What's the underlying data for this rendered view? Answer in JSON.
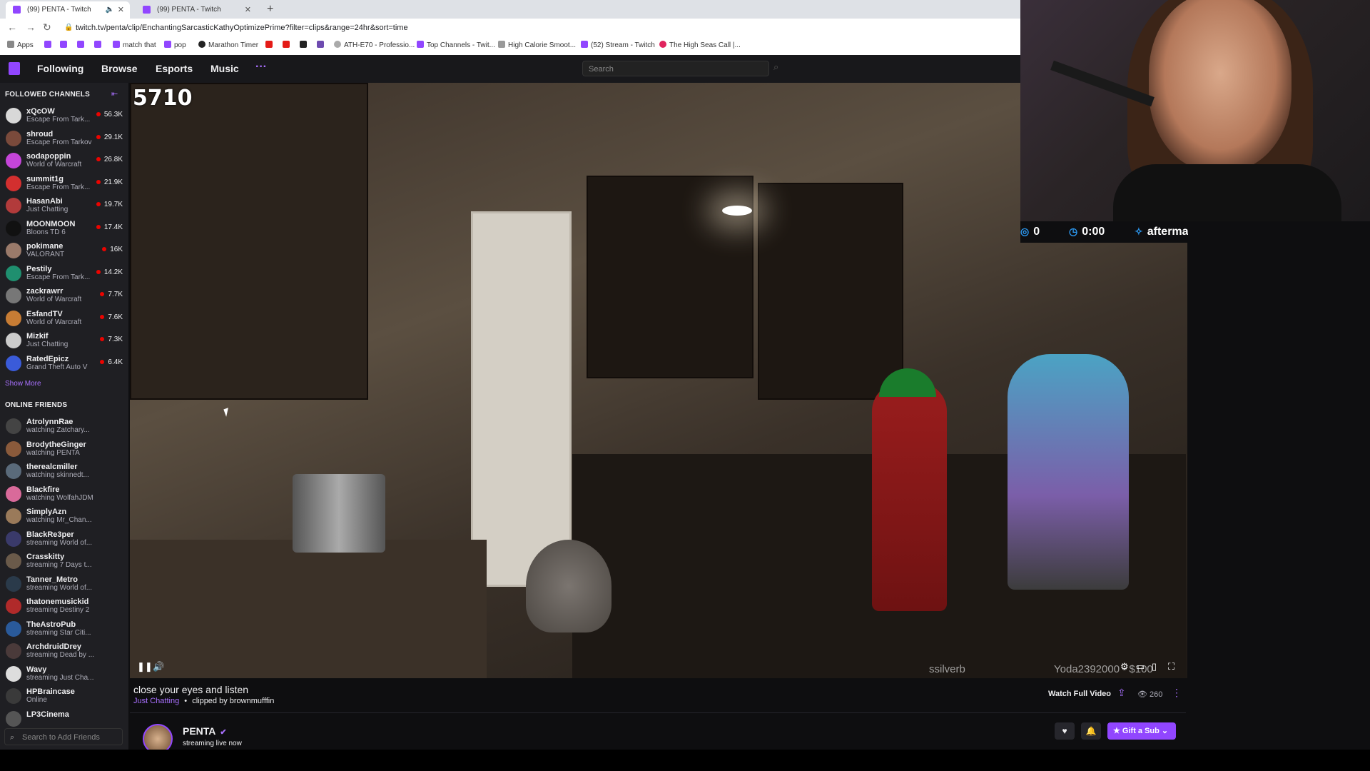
{
  "browser": {
    "tabs": [
      {
        "title": "(99) PENTA - Twitch"
      },
      {
        "title": "(99) PENTA - Twitch"
      }
    ],
    "url": "twitch.tv/penta/clip/EnchantingSarcasticKathyOptimizePrime?filter=clips&range=24hr&sort=time",
    "bookmarks": [
      {
        "label": "Apps",
        "color": "#888888"
      },
      {
        "label": "",
        "color": "#9146ff"
      },
      {
        "label": "",
        "color": "#9146ff"
      },
      {
        "label": "",
        "color": "#9146ff"
      },
      {
        "label": "",
        "color": "#9146ff"
      },
      {
        "label": "match that",
        "color": "#9146ff"
      },
      {
        "label": "pop",
        "color": "#9146ff"
      },
      {
        "label": "Marathon Timer",
        "color": "#222222"
      },
      {
        "label": "",
        "color": "#e41b17"
      },
      {
        "label": "",
        "color": "#e41b17"
      },
      {
        "label": "",
        "color": "#222222"
      },
      {
        "label": "",
        "color": "#6e4bb0"
      },
      {
        "label": "ATH-E70 - Professio...",
        "color": "#aaaaaa"
      },
      {
        "label": "Top Channels - Twit...",
        "color": "#9146ff"
      },
      {
        "label": "High Calorie Smoot...",
        "color": "#999999"
      },
      {
        "label": "(52) Stream - Twitch",
        "color": "#9146ff"
      },
      {
        "label": "The High Seas Call |...",
        "color": "#e0245e"
      }
    ]
  },
  "twitch_nav": {
    "links": [
      "Following",
      "Browse",
      "Esports",
      "Music"
    ],
    "more": "···",
    "search_placeholder": "Search"
  },
  "sidebar": {
    "followed_header": "FOLLOWED CHANNELS",
    "followed": [
      {
        "name": "xQcOW",
        "game": "Escape From Tark...",
        "viewers": "56.3K",
        "color": "#d8d8d8"
      },
      {
        "name": "shroud",
        "game": "Escape From Tarkov",
        "viewers": "29.1K",
        "color": "#7a4a3b"
      },
      {
        "name": "sodapoppin",
        "game": "World of Warcraft",
        "viewers": "26.8K",
        "color": "#c545d9"
      },
      {
        "name": "summit1g",
        "game": "Escape From Tark...",
        "viewers": "21.9K",
        "color": "#d32f2f"
      },
      {
        "name": "HasanAbi",
        "game": "Just Chatting",
        "viewers": "19.7K",
        "color": "#b23b3b"
      },
      {
        "name": "MOONMOON",
        "game": "Bloons TD 6",
        "viewers": "17.4K",
        "color": "#111111"
      },
      {
        "name": "pokimane",
        "game": "VALORANT",
        "viewers": "16K",
        "color": "#9a7a6a"
      },
      {
        "name": "Pestily",
        "game": "Escape From Tark...",
        "viewers": "14.2K",
        "color": "#1f8f6f"
      },
      {
        "name": "zackrawrr",
        "game": "World of Warcraft",
        "viewers": "7.7K",
        "color": "#777777"
      },
      {
        "name": "EsfandTV",
        "game": "World of Warcraft",
        "viewers": "7.6K",
        "color": "#c77c34"
      },
      {
        "name": "Mizkif",
        "game": "Just Chatting",
        "viewers": "7.3K",
        "color": "#cccccc"
      },
      {
        "name": "RatedEpicz",
        "game": "Grand Theft Auto V",
        "viewers": "6.4K",
        "color": "#3a5bd9"
      }
    ],
    "show_more": "Show More",
    "friends_header": "ONLINE FRIENDS",
    "friends": [
      {
        "name": "AtrolynnRae",
        "status": "watching Zatchary...",
        "color": "#444444"
      },
      {
        "name": "BrodytheGinger",
        "status": "watching PENTA",
        "color": "#8a5a3b"
      },
      {
        "name": "therealcmiller",
        "status": "watching skinnedt...",
        "color": "#5a6a7a"
      },
      {
        "name": "Blackfire",
        "status": "watching WolfahJDM",
        "color": "#d96a9a"
      },
      {
        "name": "SimplyAzn",
        "status": "watching Mr_Chan...",
        "color": "#9a7a5a"
      },
      {
        "name": "BlackRe3per",
        "status": "streaming World of...",
        "color": "#3a3a6a"
      },
      {
        "name": "Crasskitty",
        "status": "streaming 7 Days t...",
        "color": "#6a5a4a"
      },
      {
        "name": "Tanner_Metro",
        "status": "streaming World of...",
        "color": "#2a3a4a"
      },
      {
        "name": "thatonemusickid",
        "status": "streaming Destiny 2",
        "color": "#b02a2a"
      },
      {
        "name": "TheAstroPub",
        "status": "streaming Star Citi...",
        "color": "#2a5a9a"
      },
      {
        "name": "ArchdruidDrey",
        "status": "streaming Dead by ...",
        "color": "#4a3a3a"
      },
      {
        "name": "Wavy",
        "status": "streaming Just Cha...",
        "color": "#dddddd"
      },
      {
        "name": "HPBraincase",
        "status": "Online",
        "color": "#3a3a3a"
      },
      {
        "name": "LP3Cinema",
        "status": "",
        "color": "#555555"
      }
    ],
    "friend_search_placeholder": "Search to Add Friends"
  },
  "video": {
    "counter": "5710",
    "overlay_left": "ssilverb",
    "overlay_right": "Yoda2392000 - $100"
  },
  "webcam_stats": {
    "count": "0",
    "timer": "0:00",
    "username": "aftermath_tony"
  },
  "clip": {
    "title": "close your eyes and listen",
    "category": "Just Chatting",
    "separator": "•",
    "clipped_by": "clipped by brownmufffin",
    "watch_full": "Watch Full Video",
    "views": "260"
  },
  "channel": {
    "name": "PENTA",
    "status": "streaming live now",
    "gift_sub": "Gift a Sub"
  }
}
